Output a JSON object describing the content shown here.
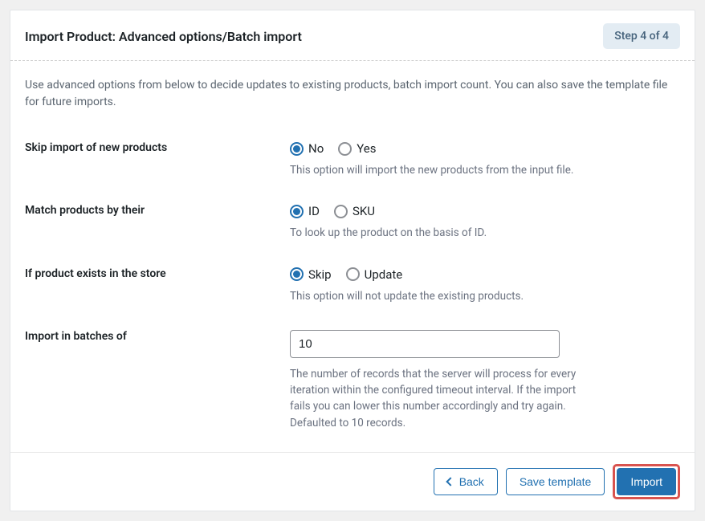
{
  "header": {
    "title": "Import Product: Advanced options/Batch import",
    "step_label": "Step 4 of 4"
  },
  "intro": "Use advanced options from below to decide updates to existing products, batch import count. You can also save the template file for future imports.",
  "fields": {
    "skip_new": {
      "label": "Skip import of new products",
      "option_no": "No",
      "option_yes": "Yes",
      "help": "This option will import the new products from the input file."
    },
    "match_by": {
      "label": "Match products by their",
      "option_id": "ID",
      "option_sku": "SKU",
      "help": "To look up the product on the basis of ID."
    },
    "exists": {
      "label": "If product exists in the store",
      "option_skip": "Skip",
      "option_update": "Update",
      "help": "This option will not update the existing products."
    },
    "batch": {
      "label": "Import in batches of",
      "value": "10",
      "help": "The number of records that the server will process for every iteration within the configured timeout interval. If the import fails you can lower this number accordingly and try again. Defaulted to 10 records."
    }
  },
  "footer": {
    "back": "Back",
    "save_template": "Save template",
    "import": "Import"
  }
}
